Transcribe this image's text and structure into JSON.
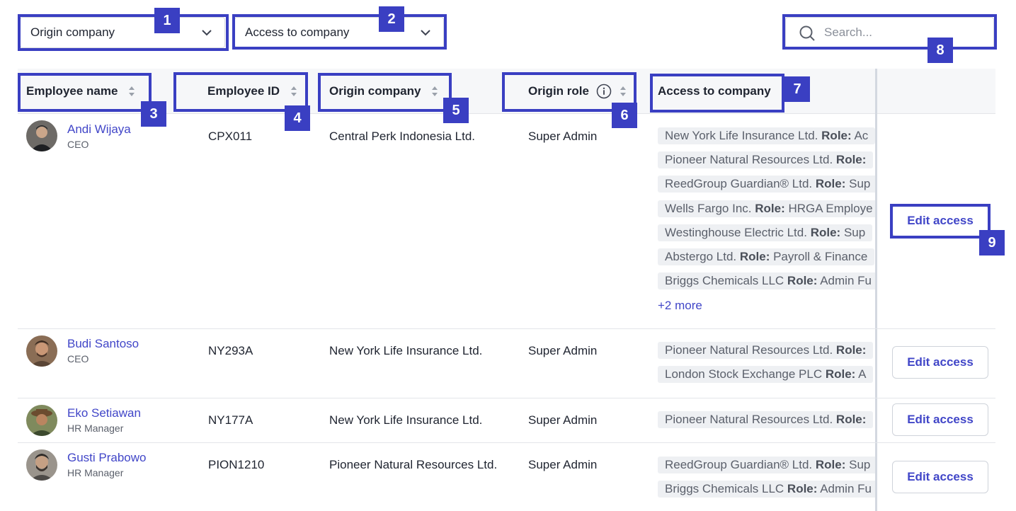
{
  "filters": {
    "origin_company_label": "Origin company",
    "access_company_label": "Access to company",
    "search_placeholder": "Search..."
  },
  "columns": {
    "employee_name": "Employee name",
    "employee_id": "Employee ID",
    "origin_company": "Origin company",
    "origin_role": "Origin role",
    "access_to_company": "Access to company"
  },
  "rows": [
    {
      "name": "Andi Wijaya",
      "title": "CEO",
      "id": "CPX011",
      "origin_company": "Central Perk Indonesia Ltd.",
      "origin_role": "Super Admin",
      "access": [
        {
          "company": "New York Life Insurance Ltd.",
          "role": "Ac"
        },
        {
          "company": "Pioneer Natural Resources Ltd.",
          "role": ""
        },
        {
          "company": "ReedGroup Guardian® Ltd.",
          "role": "Sup"
        },
        {
          "company": "Wells Fargo Inc.",
          "role": "HRGA Employe"
        },
        {
          "company": "Westinghouse Electric Ltd.",
          "role": "Sup"
        },
        {
          "company": "Abstergo Ltd.",
          "role": "Payroll & Finance"
        },
        {
          "company": "Briggs Chemicals LLC",
          "role": "Admin Fu"
        }
      ],
      "more": "+2 more",
      "action": "Edit access"
    },
    {
      "name": "Budi Santoso",
      "title": "CEO",
      "id": "NY293A",
      "origin_company": "New York Life Insurance Ltd.",
      "origin_role": "Super Admin",
      "access": [
        {
          "company": "Pioneer Natural Resources Ltd.",
          "role": ""
        },
        {
          "company": "London Stock Exchange PLC",
          "role": "A"
        }
      ],
      "action": "Edit access"
    },
    {
      "name": "Eko Setiawan",
      "title": "HR Manager",
      "id": "NY177A",
      "origin_company": "New York Life Insurance Ltd.",
      "origin_role": "Super Admin",
      "access": [
        {
          "company": "Pioneer Natural Resources Ltd.",
          "role": ""
        }
      ],
      "action": "Edit access"
    },
    {
      "name": "Gusti Prabowo",
      "title": "HR Manager",
      "id": "PION1210",
      "origin_company": "Pioneer Natural Resources Ltd.",
      "origin_role": "Super Admin",
      "access": [
        {
          "company": "ReedGroup Guardian® Ltd.",
          "role": "Sup"
        },
        {
          "company": "Briggs Chemicals LLC",
          "role": "Admin Fu"
        }
      ],
      "action": "Edit access"
    }
  ],
  "role_prefix": "Role:",
  "badges": [
    "1",
    "2",
    "3",
    "4",
    "5",
    "6",
    "7",
    "8",
    "9"
  ],
  "colors": {
    "accent": "#3a3fc2",
    "link": "#4146c8"
  }
}
